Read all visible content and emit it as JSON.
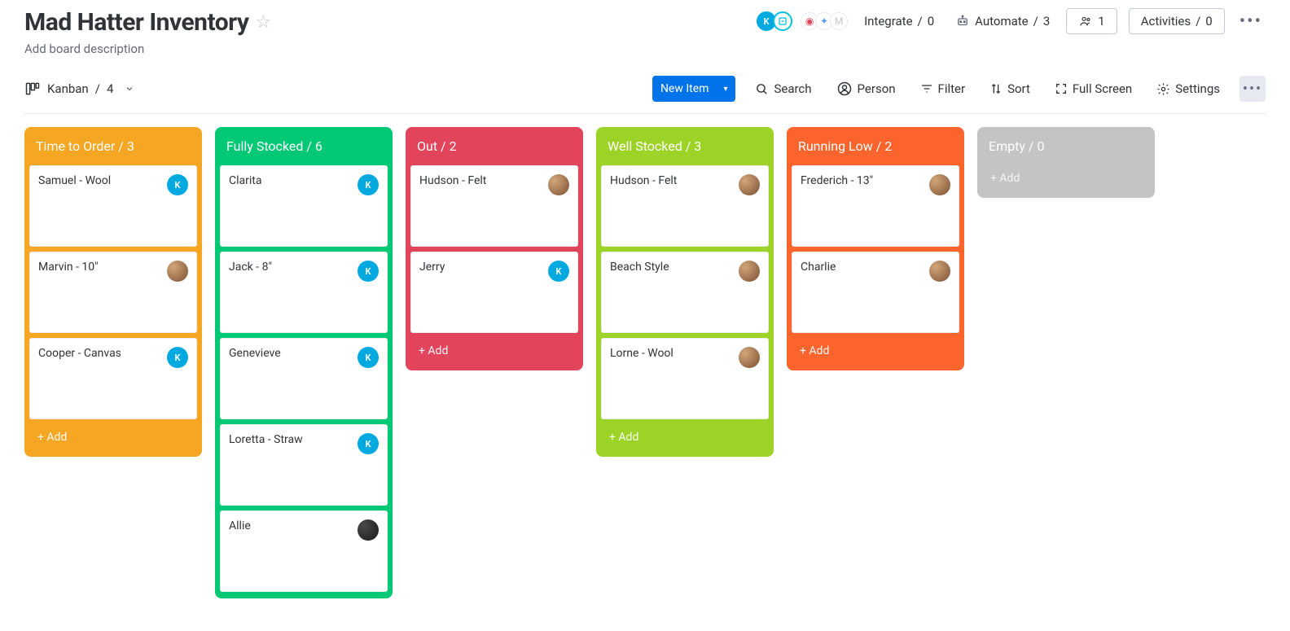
{
  "header": {
    "title": "Mad Hatter Inventory",
    "description_placeholder": "Add board description",
    "integrate_label": "Integrate",
    "integrate_count": 0,
    "automate_label": "Automate",
    "automate_count": 3,
    "members_count": 1,
    "activities_label": "Activities",
    "activities_count": 0
  },
  "toolbar": {
    "view_name": "Kanban",
    "view_count": 4,
    "new_item_label": "New Item",
    "search_label": "Search",
    "person_label": "Person",
    "filter_label": "Filter",
    "sort_label": "Sort",
    "fullscreen_label": "Full Screen",
    "settings_label": "Settings"
  },
  "avatars": {
    "k": {
      "type": "letter",
      "letter": "K",
      "class": "av-k"
    },
    "p1": {
      "type": "photo",
      "class": "av-p1"
    },
    "p2": {
      "type": "photo",
      "class": "av-p2"
    }
  },
  "add_label": "+ Add",
  "columns": [
    {
      "id": "time_to_order",
      "title": "Time to Order",
      "count": 3,
      "color_class": "c-orange",
      "cards": [
        {
          "title": "Samuel - Wool",
          "avatar": "k"
        },
        {
          "title": "Marvin - 10\"",
          "avatar": "p1"
        },
        {
          "title": "Cooper - Canvas",
          "avatar": "k"
        }
      ]
    },
    {
      "id": "fully_stocked",
      "title": "Fully Stocked",
      "count": 6,
      "color_class": "c-green",
      "cards": [
        {
          "title": "Clarita",
          "avatar": "k"
        },
        {
          "title": "Jack - 8\"",
          "avatar": "k"
        },
        {
          "title": "Genevieve",
          "avatar": "k"
        },
        {
          "title": "Loretta - Straw",
          "avatar": "k"
        },
        {
          "title": "Allie",
          "avatar": "p2"
        }
      ]
    },
    {
      "id": "out",
      "title": "Out",
      "count": 2,
      "color_class": "c-pink",
      "cards": [
        {
          "title": "Hudson - Felt",
          "avatar": "p1"
        },
        {
          "title": "Jerry",
          "avatar": "k"
        }
      ]
    },
    {
      "id": "well_stocked",
      "title": "Well Stocked",
      "count": 3,
      "color_class": "c-lime",
      "cards": [
        {
          "title": "Hudson - Felt",
          "avatar": "p1"
        },
        {
          "title": "Beach Style",
          "avatar": "p1"
        },
        {
          "title": "Lorne - Wool",
          "avatar": "p1"
        }
      ]
    },
    {
      "id": "running_low",
      "title": "Running Low",
      "count": 2,
      "color_class": "c-red",
      "cards": [
        {
          "title": "Frederich - 13\"",
          "avatar": "p1"
        },
        {
          "title": "Charlie",
          "avatar": "p1"
        }
      ]
    },
    {
      "id": "empty",
      "title": "Empty",
      "count": 0,
      "color_class": "c-grey",
      "cards": []
    }
  ]
}
